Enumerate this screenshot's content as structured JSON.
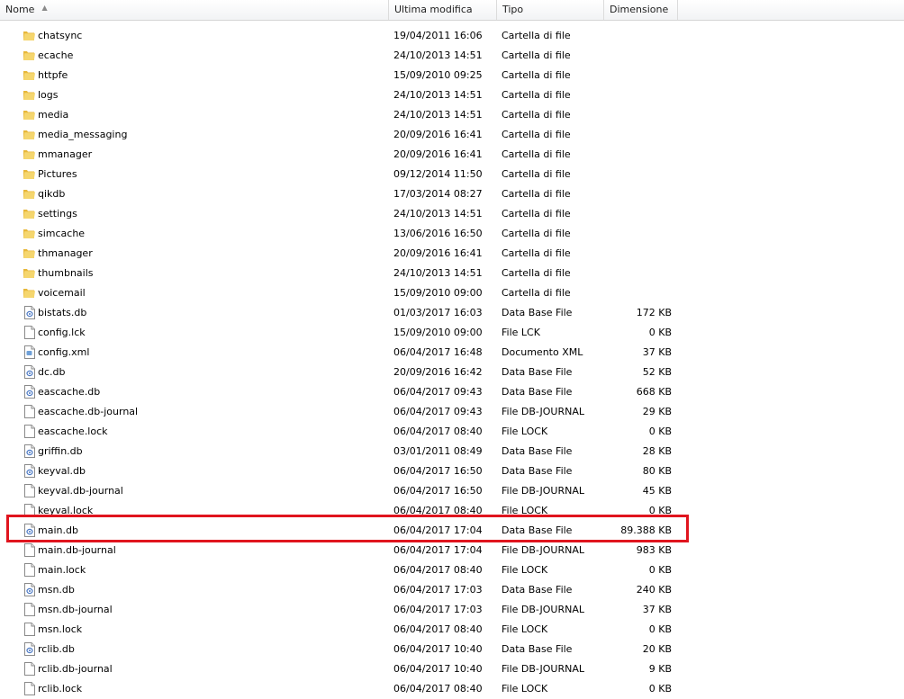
{
  "columns": {
    "name": "Nome",
    "modified": "Ultima modifica",
    "type": "Tipo",
    "size": "Dimensione"
  },
  "files": [
    {
      "name": "chatsync",
      "modified": "19/04/2011 16:06",
      "type": "Cartella di file",
      "size": "",
      "icon": "folder-icon"
    },
    {
      "name": "ecache",
      "modified": "24/10/2013 14:51",
      "type": "Cartella di file",
      "size": "",
      "icon": "folder-icon"
    },
    {
      "name": "httpfe",
      "modified": "15/09/2010 09:25",
      "type": "Cartella di file",
      "size": "",
      "icon": "folder-icon"
    },
    {
      "name": "logs",
      "modified": "24/10/2013 14:51",
      "type": "Cartella di file",
      "size": "",
      "icon": "folder-icon"
    },
    {
      "name": "media",
      "modified": "24/10/2013 14:51",
      "type": "Cartella di file",
      "size": "",
      "icon": "folder-icon"
    },
    {
      "name": "media_messaging",
      "modified": "20/09/2016 16:41",
      "type": "Cartella di file",
      "size": "",
      "icon": "folder-icon"
    },
    {
      "name": "mmanager",
      "modified": "20/09/2016 16:41",
      "type": "Cartella di file",
      "size": "",
      "icon": "folder-icon"
    },
    {
      "name": "Pictures",
      "modified": "09/12/2014 11:50",
      "type": "Cartella di file",
      "size": "",
      "icon": "folder-icon"
    },
    {
      "name": "qikdb",
      "modified": "17/03/2014 08:27",
      "type": "Cartella di file",
      "size": "",
      "icon": "folder-icon"
    },
    {
      "name": "settings",
      "modified": "24/10/2013 14:51",
      "type": "Cartella di file",
      "size": "",
      "icon": "folder-icon"
    },
    {
      "name": "simcache",
      "modified": "13/06/2016 16:50",
      "type": "Cartella di file",
      "size": "",
      "icon": "folder-icon"
    },
    {
      "name": "thmanager",
      "modified": "20/09/2016 16:41",
      "type": "Cartella di file",
      "size": "",
      "icon": "folder-icon"
    },
    {
      "name": "thumbnails",
      "modified": "24/10/2013 14:51",
      "type": "Cartella di file",
      "size": "",
      "icon": "folder-icon"
    },
    {
      "name": "voicemail",
      "modified": "15/09/2010 09:00",
      "type": "Cartella di file",
      "size": "",
      "icon": "folder-icon"
    },
    {
      "name": "bistats.db",
      "modified": "01/03/2017 16:03",
      "type": "Data Base File",
      "size": "172 KB",
      "icon": "database-file-icon"
    },
    {
      "name": "config.lck",
      "modified": "15/09/2010 09:00",
      "type": "File LCK",
      "size": "0 KB",
      "icon": "blank-file-icon"
    },
    {
      "name": "config.xml",
      "modified": "06/04/2017 16:48",
      "type": "Documento XML",
      "size": "37 KB",
      "icon": "xml-file-icon"
    },
    {
      "name": "dc.db",
      "modified": "20/09/2016 16:42",
      "type": "Data Base File",
      "size": "52 KB",
      "icon": "database-file-icon"
    },
    {
      "name": "eascache.db",
      "modified": "06/04/2017 09:43",
      "type": "Data Base File",
      "size": "668 KB",
      "icon": "database-file-icon"
    },
    {
      "name": "eascache.db-journal",
      "modified": "06/04/2017 09:43",
      "type": "File DB-JOURNAL",
      "size": "29 KB",
      "icon": "blank-file-icon"
    },
    {
      "name": "eascache.lock",
      "modified": "06/04/2017 08:40",
      "type": "File LOCK",
      "size": "0 KB",
      "icon": "blank-file-icon"
    },
    {
      "name": "griffin.db",
      "modified": "03/01/2011 08:49",
      "type": "Data Base File",
      "size": "28 KB",
      "icon": "database-file-icon"
    },
    {
      "name": "keyval.db",
      "modified": "06/04/2017 16:50",
      "type": "Data Base File",
      "size": "80 KB",
      "icon": "database-file-icon"
    },
    {
      "name": "keyval.db-journal",
      "modified": "06/04/2017 16:50",
      "type": "File DB-JOURNAL",
      "size": "45 KB",
      "icon": "blank-file-icon"
    },
    {
      "name": "keyval.lock",
      "modified": "06/04/2017 08:40",
      "type": "File LOCK",
      "size": "0 KB",
      "icon": "blank-file-icon"
    },
    {
      "name": "main.db",
      "modified": "06/04/2017 17:04",
      "type": "Data Base File",
      "size": "89.388 KB",
      "icon": "database-file-icon"
    },
    {
      "name": "main.db-journal",
      "modified": "06/04/2017 17:04",
      "type": "File DB-JOURNAL",
      "size": "983 KB",
      "icon": "blank-file-icon"
    },
    {
      "name": "main.lock",
      "modified": "06/04/2017 08:40",
      "type": "File LOCK",
      "size": "0 KB",
      "icon": "blank-file-icon"
    },
    {
      "name": "msn.db",
      "modified": "06/04/2017 17:03",
      "type": "Data Base File",
      "size": "240 KB",
      "icon": "database-file-icon"
    },
    {
      "name": "msn.db-journal",
      "modified": "06/04/2017 17:03",
      "type": "File DB-JOURNAL",
      "size": "37 KB",
      "icon": "blank-file-icon"
    },
    {
      "name": "msn.lock",
      "modified": "06/04/2017 08:40",
      "type": "File LOCK",
      "size": "0 KB",
      "icon": "blank-file-icon"
    },
    {
      "name": "rclib.db",
      "modified": "06/04/2017 10:40",
      "type": "Data Base File",
      "size": "20 KB",
      "icon": "database-file-icon"
    },
    {
      "name": "rclib.db-journal",
      "modified": "06/04/2017 10:40",
      "type": "File DB-JOURNAL",
      "size": "9 KB",
      "icon": "blank-file-icon"
    },
    {
      "name": "rclib.lock",
      "modified": "06/04/2017 08:40",
      "type": "File LOCK",
      "size": "0 KB",
      "icon": "blank-file-icon"
    }
  ],
  "highlighted_file": "main.db",
  "colors": {
    "highlight": "#e0141e",
    "folder": "#f0c94a"
  }
}
